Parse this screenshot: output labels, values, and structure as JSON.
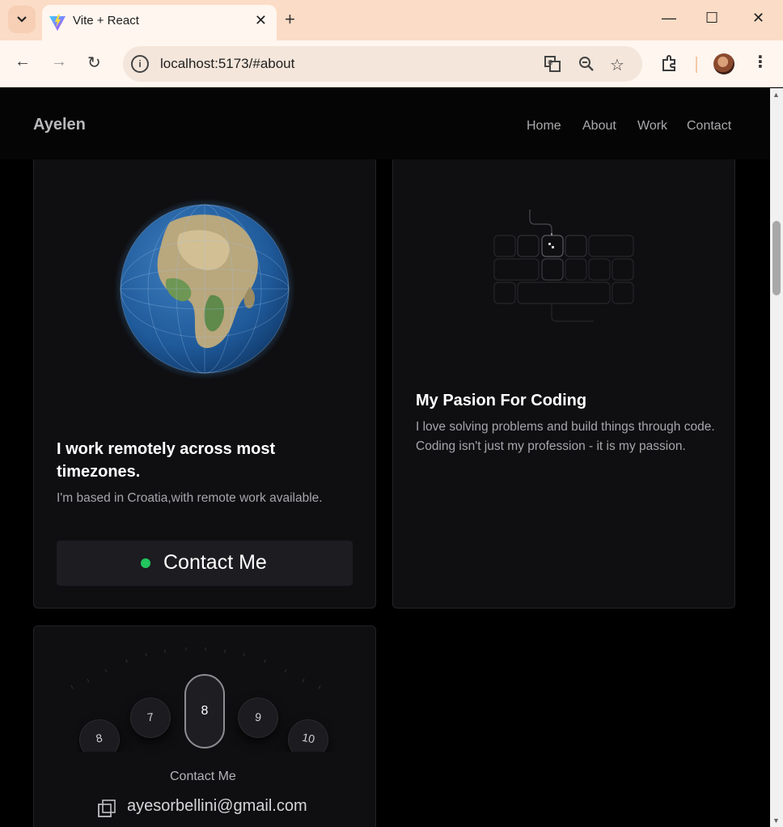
{
  "browser": {
    "tab_title": "Vite + React",
    "url": "localhost:5173/#about",
    "icons": [
      "tab-list-icon",
      "vite-favicon-icon",
      "close-tab-icon",
      "new-tab-icon",
      "minimize-icon",
      "maximize-icon",
      "close-window-icon",
      "back-icon",
      "forward-icon",
      "reload-icon",
      "site-info-icon",
      "translate-icon",
      "zoom-icon",
      "bookmark-star-icon",
      "extensions-icon",
      "profile-avatar",
      "menu-icon"
    ]
  },
  "nav": {
    "brand": "Ayelen",
    "links": [
      "Home",
      "About",
      "Work",
      "Contact"
    ]
  },
  "globe_card": {
    "title": "I work remotely across most timezones.",
    "subtitle": "I'm based in Croatia,with remote work available.",
    "button_label": "Contact Me",
    "status_color": "#22c55e"
  },
  "coding_card": {
    "title": "My Pasion For Coding",
    "text": "I love solving problems and build things through code. Coding isn't just my profession - it is my passion."
  },
  "contact_card": {
    "dials": [
      "8",
      "7",
      "8",
      "9",
      "10"
    ],
    "label": "Contact Me",
    "email": "ayesorbellini@gmail.com"
  }
}
